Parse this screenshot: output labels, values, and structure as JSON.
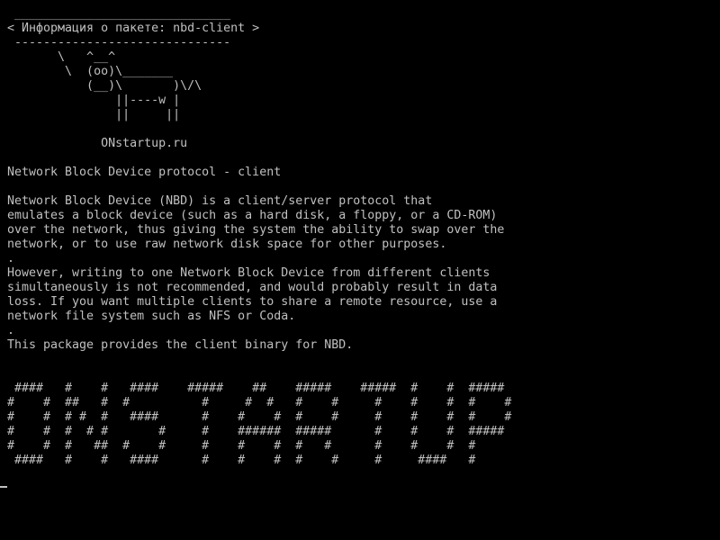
{
  "terminal": {
    "background": "#000000",
    "foreground": "#c0c0c0",
    "lines": [
      " ______________________________",
      "< Информация о пакете: nbd-client >",
      " ------------------------------",
      "       \\   ^__^",
      "        \\  (oo)\\_______",
      "           (__)\\       )\\/\\",
      "               ||----w |",
      "               ||     ||",
      "",
      "             ONstartup.ru",
      "",
      "Network Block Device protocol - client",
      "",
      "Network Block Device (NBD) is a client/server protocol that",
      "emulates a block device (such as a hard disk, a floppy, or a CD-ROM)",
      "over the network, thus giving the system the ability to swap over the",
      "network, or to use raw network disk space for other purposes.",
      ".",
      "However, writing to one Network Block Device from different clients",
      "simultaneously is not recommended, and would probably result in data",
      "loss. If you want multiple clients to share a remote resource, use a",
      "network file system such as NFS or Coda.",
      ".",
      "This package provides the client binary for NBD.",
      "",
      "",
      " ####   #    #   ####    #####    ##    #####    #####  #    #  #####",
      "#    #  ##   #  #          #     #  #   #    #     #    #    #  #    #",
      "#    #  # #  #   ####      #    #    #  #    #     #    #    #  #    #",
      "#    #  #  # #       #     #    ######  #####      #    #    #  #####",
      "#    #  #   ##  #    #     #    #    #  #   #      #    #    #  #",
      " ####   #    #   ####      #    #    #  #    #     #     ####   #"
    ]
  }
}
